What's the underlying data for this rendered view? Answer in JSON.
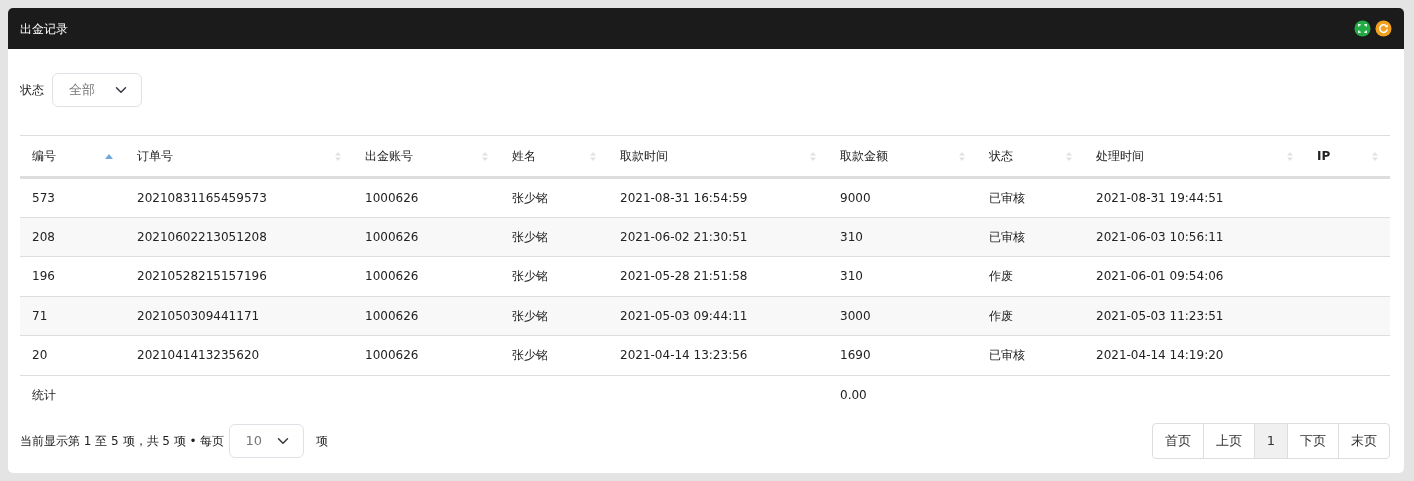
{
  "window": {
    "title": "出金记录"
  },
  "header_icons": [
    {
      "kind": "fullscreen",
      "color": "#22aa44"
    },
    {
      "kind": "refresh",
      "color": "#f0a020"
    }
  ],
  "filter": {
    "label": "状态",
    "value": "全部"
  },
  "table": {
    "columns": [
      {
        "label": "编号",
        "sorted": true
      },
      {
        "label": "订单号",
        "sorted": false
      },
      {
        "label": "出金账号",
        "sorted": false
      },
      {
        "label": "姓名",
        "sorted": false
      },
      {
        "label": "取款时间",
        "sorted": false
      },
      {
        "label": "取款金额",
        "sorted": false
      },
      {
        "label": "状态",
        "sorted": false
      },
      {
        "label": "处理时间",
        "sorted": false
      },
      {
        "label": "IP",
        "sorted": false
      }
    ],
    "rows": [
      [
        "573",
        "20210831165459573",
        "1000626",
        "张少铭",
        "2021-08-31 16:54:59",
        "9000",
        "已审核",
        "2021-08-31 19:44:51"
      ],
      [
        "208",
        "20210602213051208",
        "1000626",
        "张少铭",
        "2021-06-02 21:30:51",
        "310",
        "已审核",
        "2021-06-03 10:56:11"
      ],
      [
        "196",
        "20210528215157196",
        "1000626",
        "张少铭",
        "2021-05-28 21:51:58",
        "310",
        "作废",
        "2021-06-01 09:54:06"
      ],
      [
        "71",
        "2021050309441171",
        "1000626",
        "张少铭",
        "2021-05-03 09:44:11",
        "3000",
        "作废",
        "2021-05-03 11:23:51"
      ],
      [
        "20",
        "2021041413235620",
        "1000626",
        "张少铭",
        "2021-04-14 13:23:56",
        "1690",
        "已审核",
        "2021-04-14 14:19:20"
      ]
    ],
    "footer": {
      "label": "统计",
      "total": "0.00"
    }
  },
  "pagination": {
    "info": "当前显示第 1 至 5 项，共 5 项 • 每页",
    "page_size": "10",
    "unit": "项",
    "pages": [
      {
        "label": "首页",
        "selected": false
      },
      {
        "label": "上页",
        "selected": false
      },
      {
        "label": "1",
        "selected": true
      },
      {
        "label": "下页",
        "selected": false
      },
      {
        "label": "末页",
        "selected": false
      }
    ]
  }
}
